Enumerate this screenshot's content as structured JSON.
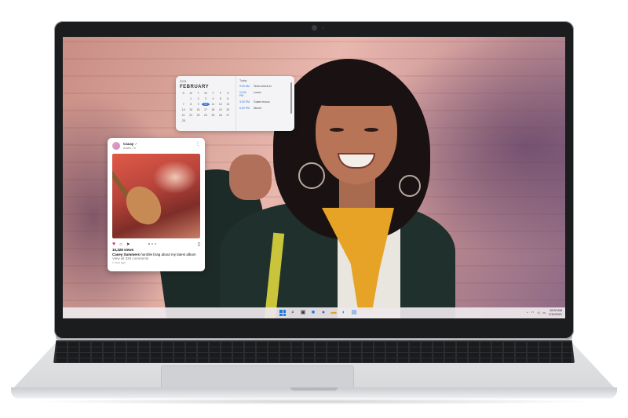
{
  "calendar": {
    "year": "2021",
    "month": "FEBRUARY",
    "weekdays": [
      "S",
      "M",
      "T",
      "W",
      "T",
      "F",
      "S"
    ],
    "days": [
      "",
      "1",
      "2",
      "3",
      "4",
      "5",
      "6",
      "7",
      "8",
      "9",
      "10",
      "11",
      "12",
      "13",
      "14",
      "15",
      "16",
      "17",
      "18",
      "19",
      "20",
      "21",
      "22",
      "23",
      "24",
      "25",
      "26",
      "27",
      "28"
    ],
    "today": "10",
    "agenda_header": "Today",
    "events": [
      {
        "time": "9:00 AM",
        "title": "Team check-in"
      },
      {
        "time": "12:00 PM",
        "title": "Lunch"
      },
      {
        "time": "3:30 PM",
        "title": "Guitar lesson"
      },
      {
        "time": "6:00 PM",
        "title": "Dinner"
      }
    ]
  },
  "post": {
    "username": "Cacay",
    "verified_mark": "✓",
    "location": "Austin, TX",
    "more_icon": "⋮",
    "views": "10,328 views",
    "caption_user": "Casey Summers",
    "caption_text": " humble brag about my latest album",
    "comments": "View all 328 comments",
    "time_ago": "1 hour ago",
    "icons": {
      "like": "heart-icon",
      "comment": "comment-icon",
      "share": "share-icon",
      "save": "bookmark-icon"
    }
  },
  "taskbar": {
    "clock_time": "10:00 AM",
    "clock_date": "2/10/2021",
    "tray_chevron": "^"
  },
  "colors": {
    "accent": "#2f6fd6",
    "like": "#e8344a",
    "scarf": "#e6a326"
  }
}
